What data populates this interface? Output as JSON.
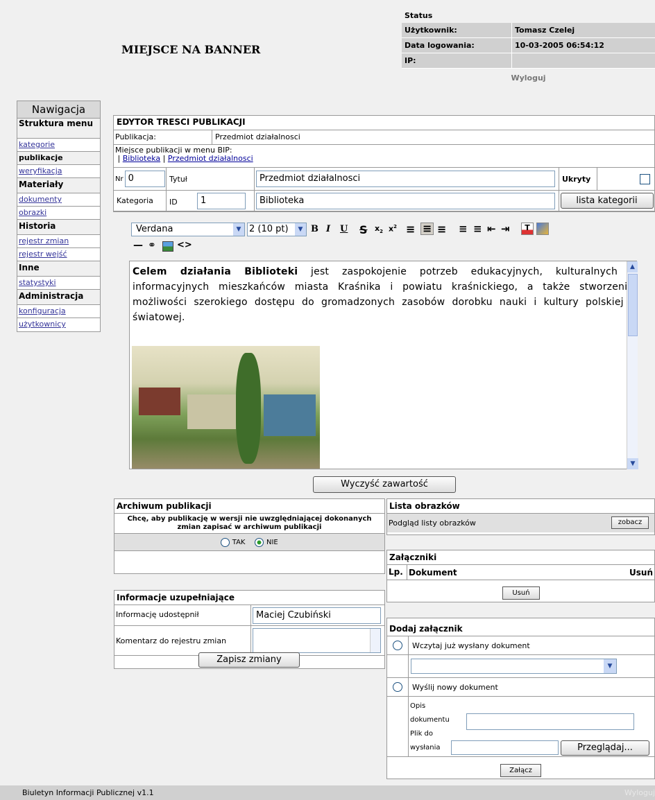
{
  "banner": "MIEJSCE NA BANNER",
  "status": {
    "title": "Status",
    "user_label": "Użytkownik:",
    "user_value": "Tomasz Czelej",
    "login_label": "Data logowania:",
    "login_value": "10-03-2005 06:54:12",
    "ip_label": "IP:",
    "ip_value": "",
    "logout": "Wyloguj"
  },
  "nav": {
    "title": "Nawigacja",
    "sections": [
      {
        "label": "Struktura menu",
        "items": [
          "kategorie",
          "publikacje",
          "weryfikacja"
        ]
      },
      {
        "label": "Materiały",
        "items": [
          "dokumenty",
          "obrazki"
        ]
      },
      {
        "label": "Historia",
        "items": [
          "rejestr zmian",
          "rejestr wejść"
        ]
      },
      {
        "label": "Inne",
        "items": [
          "statystyki"
        ]
      },
      {
        "label": "Administracja",
        "items": [
          "konfiguracja",
          "użytkownicy"
        ]
      }
    ]
  },
  "editor": {
    "title": "EDYTOR TRESCI PUBLIKACJI",
    "publication_label": "Publikacja:",
    "publication_value": "Przedmiot działalnosci",
    "place_label": "Miejsce publikacji w menu BIP:",
    "place_sep": "|",
    "place_links": [
      "Biblioteka",
      "Przedmiot działalnosci"
    ],
    "nr_label": "Nr",
    "nr_value": "0",
    "title_label": "Tytuł",
    "title_value": "Przedmiot działalnosci",
    "hidden_label": "Ukryty",
    "category_label": "Kategoria",
    "id_label": "ID",
    "id_value": "1",
    "category_value": "Biblioteka",
    "category_list_button": "lista kategorii",
    "font_select": "Verdana",
    "size_select": "2 (10 pt)",
    "content_bold": "Celem działania Biblioteki",
    "content_text": " jest zaspokojenie potrzeb edukacyjnych, kulturalnych i informacyjnych mieszkańców miasta Kraśnika i powiatu kraśnickiego, a także stworzenie możliwości szerokiego dostępu do gromadzonych zasobów dorobku nauki i kultury polskiej i światowej.",
    "clear_button": "Wyczyść zawartość"
  },
  "archive": {
    "title": "Archiwum publikacji",
    "question": "Chcę, aby publikację w wersji nie uwzględniającej dokonanych zmian zapisać w archiwum publikacji",
    "yes": "TAK",
    "no": "NIE"
  },
  "info": {
    "title": "Informacje uzupełniające",
    "shared_label": "Informację udostępnił",
    "shared_value": "Maciej Czubiński",
    "comment_label": "Komentarz do rejestru zmian",
    "save_button": "Zapisz zmiany"
  },
  "images": {
    "title": "Lista obrazków",
    "preview_label": "Podgląd listy obrazków",
    "view_button": "zobacz"
  },
  "attachments": {
    "title": "Załączniki",
    "col_lp": "Lp.",
    "col_doc": "Dokument",
    "col_delete": "Usuń",
    "delete_button": "Usuń"
  },
  "add_attachment": {
    "title": "Dodaj załącznik",
    "load_existing": "Wczytaj już wysłany dokument",
    "send_new": "Wyślij nowy dokument",
    "desc_label_1": "Opis",
    "desc_label_2": "dokumentu",
    "file_label_1": "Plik do",
    "file_label_2": "wysłania",
    "browse_button": "Przeglądaj...",
    "attach_button": "Załącz"
  },
  "footer": {
    "version": "Biuletyn Informacji Publicznej v1.1",
    "logout": "Wyloguj"
  }
}
